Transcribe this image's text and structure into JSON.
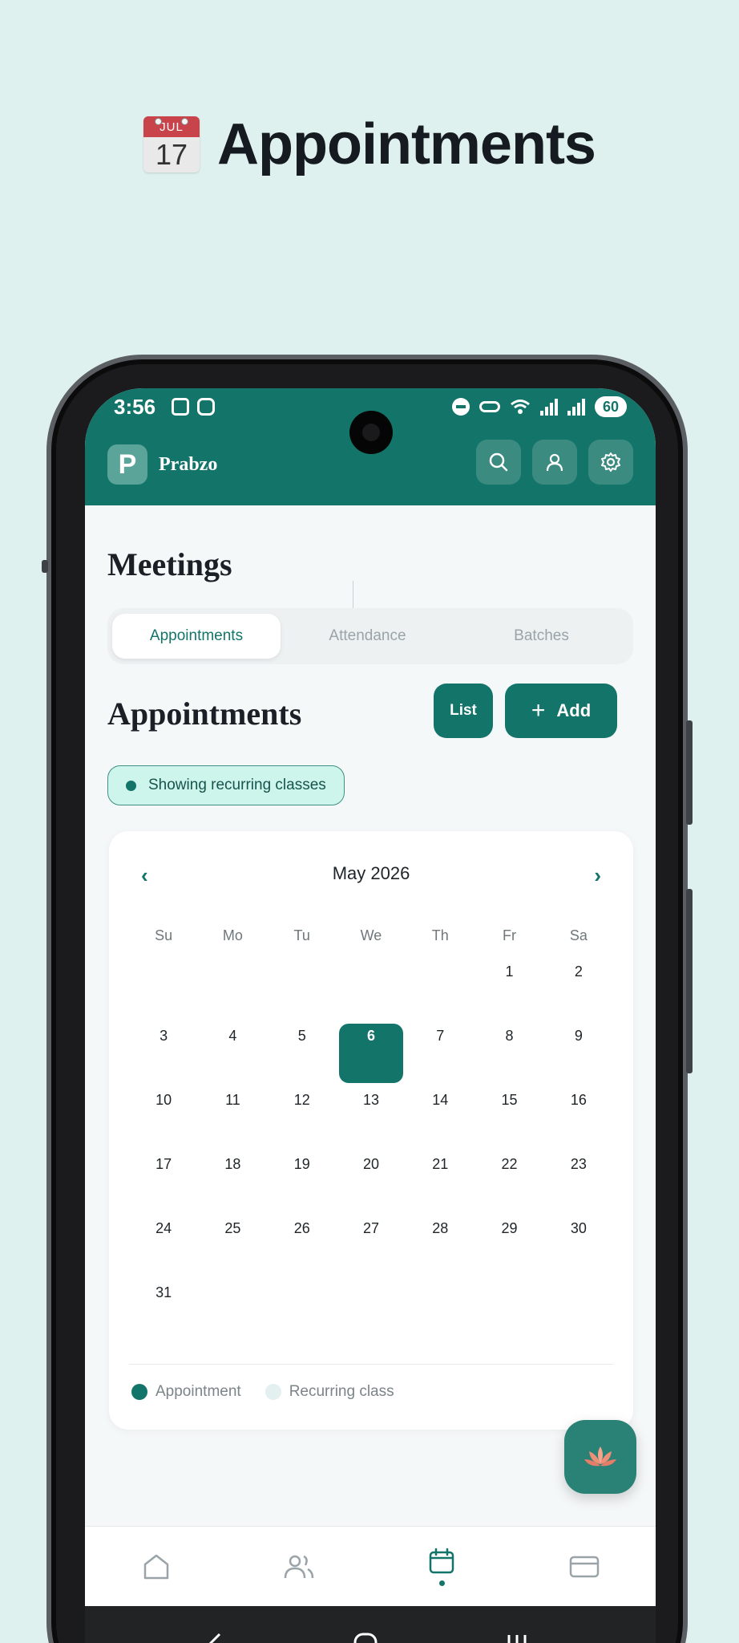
{
  "promo": {
    "emoji_month": "JUL",
    "emoji_day": "17",
    "title": "Appointments"
  },
  "status_bar": {
    "time": "3:56",
    "battery": "60"
  },
  "header": {
    "brand_initial": "P",
    "brand_name": "Prabzo"
  },
  "page": {
    "title": "Meetings",
    "tabs": [
      {
        "label": "Appointments",
        "active": true
      },
      {
        "label": "Attendance",
        "active": false
      },
      {
        "label": "Batches",
        "active": false
      }
    ],
    "section_title": "Appointments",
    "list_button": "List",
    "add_button": "Add",
    "recurring_badge": "Showing recurring classes"
  },
  "calendar": {
    "prev": "‹",
    "next": "›",
    "month_label": "May 2026",
    "weekdays": [
      "Su",
      "Mo",
      "Tu",
      "We",
      "Th",
      "Fr",
      "Sa"
    ],
    "weeks": [
      [
        "",
        "",
        "",
        "",
        "",
        "1",
        "2"
      ],
      [
        "3",
        "4",
        "5",
        "6",
        "7",
        "8",
        "9"
      ],
      [
        "10",
        "11",
        "12",
        "13",
        "14",
        "15",
        "16"
      ],
      [
        "17",
        "18",
        "19",
        "20",
        "21",
        "22",
        "23"
      ],
      [
        "24",
        "25",
        "26",
        "27",
        "28",
        "29",
        "30"
      ],
      [
        "31",
        "",
        "",
        "",
        "",
        "",
        ""
      ]
    ],
    "selected_day": "6",
    "legend": [
      {
        "label": "Appointment",
        "color": "#137469"
      },
      {
        "label": "Recurring class",
        "color": "#e4eff0"
      }
    ]
  },
  "bottom_nav": {
    "items": [
      {
        "icon": "home-icon",
        "active": false
      },
      {
        "icon": "users-icon",
        "active": false
      },
      {
        "icon": "calendar-icon",
        "active": true
      },
      {
        "icon": "card-icon",
        "active": false
      }
    ]
  },
  "colors": {
    "primary": "#137469",
    "background": "#dff1ee",
    "badge_bg": "#cef5ec"
  }
}
